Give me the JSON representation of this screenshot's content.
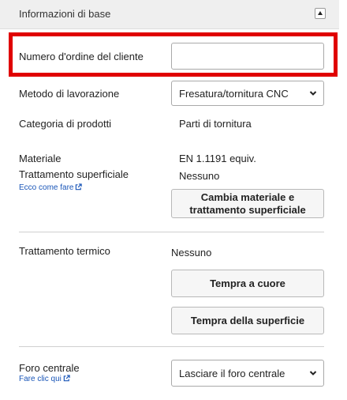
{
  "header": {
    "title": "Informazioni di base",
    "collapse_icon": "triangle-up-icon"
  },
  "customer_order": {
    "label": "Numero d'ordine del cliente",
    "value": "",
    "highlight_color": "#e00000"
  },
  "processing_method": {
    "label": "Metodo di lavorazione",
    "selected": "Fresatura/tornitura CNC"
  },
  "product_category": {
    "label": "Categoria di prodotti",
    "value": "Parti di tornitura"
  },
  "material": {
    "label": "Materiale",
    "value": "EN 1.1191 equiv."
  },
  "surface_treatment": {
    "label": "Trattamento superficiale",
    "value": "Nessuno",
    "link": "Ecco come fare",
    "change_button": "Cambia materiale e trattamento superficiale"
  },
  "heat_treatment": {
    "label": "Trattamento termico",
    "value": "Nessuno",
    "button_through": "Tempra a cuore",
    "button_surface": "Tempra della superficie"
  },
  "center_hole": {
    "label": "Foro centrale",
    "link": "Fare clic qui",
    "selected": "Lasciare il foro centrale"
  },
  "colors": {
    "link": "#1a56b8",
    "highlight": "#e00000",
    "header_bg": "#efefef"
  }
}
